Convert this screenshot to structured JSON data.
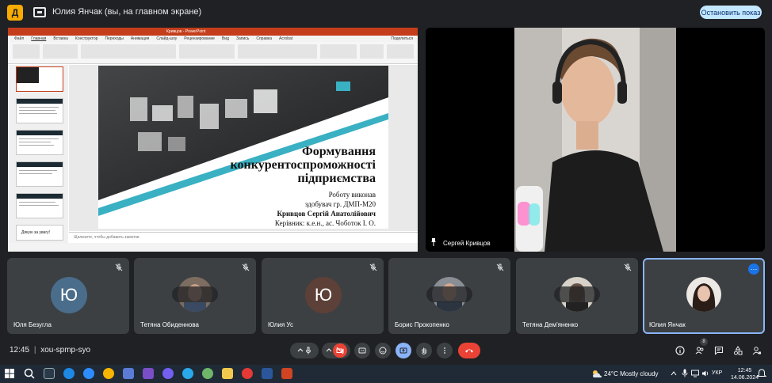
{
  "top_bar": {
    "presenting_title": "Юлия Янчак (вы, на главном экране)",
    "stop_button": "Остановить показ"
  },
  "shared_screen": {
    "ppt_title": "Кривцов - PowerPoint",
    "menu_items": [
      "Файл",
      "Главная",
      "Вставка",
      "Конструктор",
      "Переходы",
      "Анимация",
      "Слайд-шоу",
      "Рецензирование",
      "Вид",
      "Запись",
      "Справка",
      "Acrobat"
    ],
    "share_label": "Поделиться",
    "notes_placeholder": "Щелкните, чтобы добавить заметки",
    "slide": {
      "title_lines": [
        "Формування",
        "конкурентоспроможності",
        "підприємства"
      ],
      "line1": "Роботу виконав",
      "line2": "здобувач гр. ДМП-М20",
      "line3": "Кривцов Сергій Анатолійович",
      "line4": "Керівник: к.е.н., ас. Чоботок І. О."
    },
    "last_thumb_text": "Дякую за увагу!"
  },
  "speaker": {
    "name": "Сергей Кривцов"
  },
  "participants": [
    {
      "name": "Юля Безугла",
      "initial": "Ю",
      "color": "#4a6d8c",
      "kind": "letter"
    },
    {
      "name": "Тетяна Обиденнова",
      "kind": "photo"
    },
    {
      "name": "Юлия Ус",
      "initial": "Ю",
      "color": "#5d4037",
      "kind": "letter"
    },
    {
      "name": "Борис Прокопенко",
      "kind": "photo"
    },
    {
      "name": "Тетяна Дем'яненко",
      "kind": "photo"
    },
    {
      "name": "Юлия Янчак",
      "kind": "photo"
    }
  ],
  "meet_bar": {
    "clock": "12:45",
    "meeting_code": "xou-spmp-syo",
    "participant_count": "8"
  },
  "taskbar": {
    "weather": "24°C  Mostly cloudy",
    "language": "УКР",
    "time": "12:45",
    "date": "14.06.2024"
  },
  "colors": {
    "hangup": "#ea4335",
    "cam_off": "#ea4335",
    "present_active": "#8ab4f8",
    "stop_button_bg": "#c2e7ff",
    "ppt_accent": "#c43e1c"
  }
}
